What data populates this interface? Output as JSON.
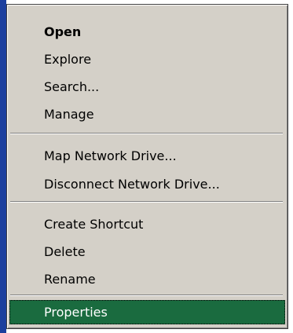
{
  "menu": {
    "items": [
      {
        "label": "Open",
        "bold": true
      },
      {
        "label": "Explore"
      },
      {
        "label": "Search..."
      },
      {
        "label": "Manage"
      },
      {
        "label": "Map Network Drive..."
      },
      {
        "label": "Disconnect Network Drive..."
      },
      {
        "label": "Create Shortcut"
      },
      {
        "label": "Delete"
      },
      {
        "label": "Rename"
      },
      {
        "label": "Properties",
        "selected": true
      }
    ]
  },
  "colors": {
    "menu_background": "#d4d0c8",
    "selection_background": "#1a6b3f",
    "selection_text": "#ffffff",
    "window_border_blue": "#1c3f9e"
  }
}
